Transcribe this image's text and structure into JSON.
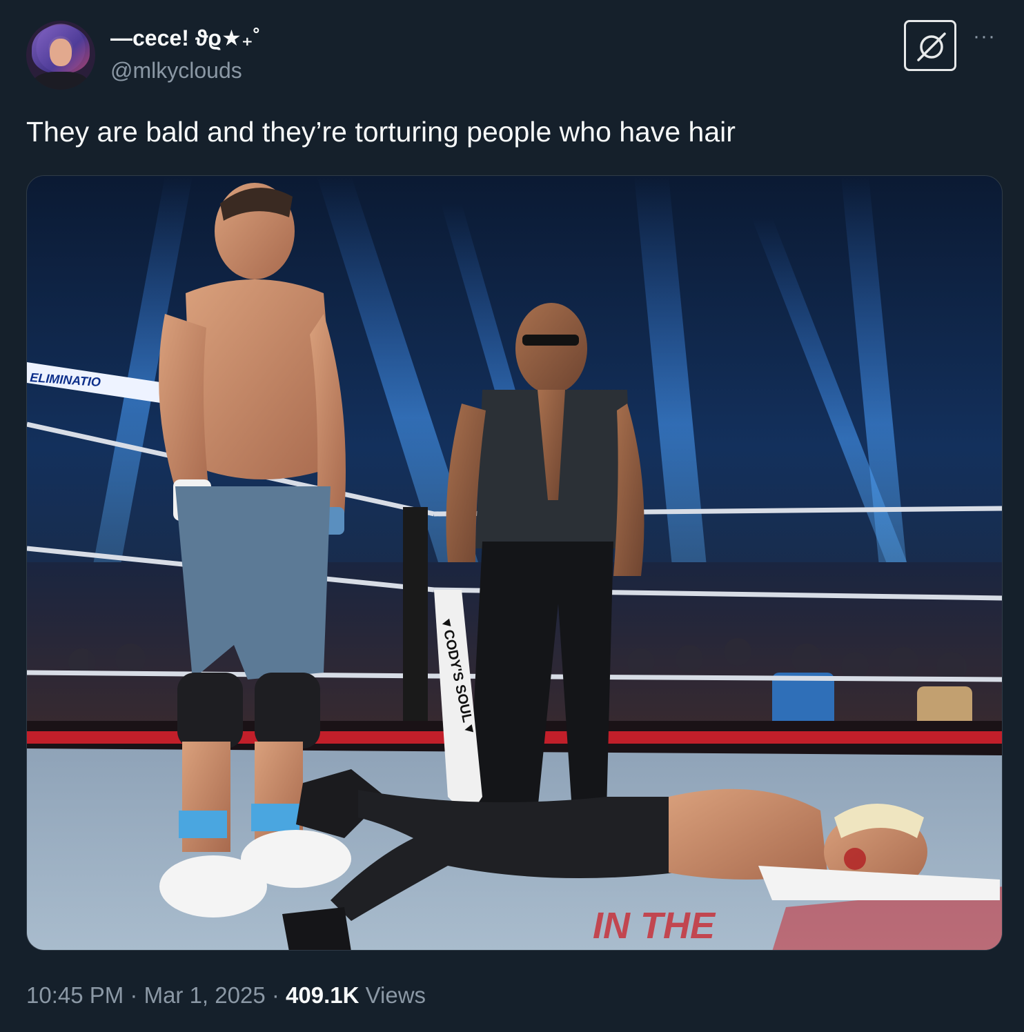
{
  "author": {
    "display_name": "—cece! ϑϱ★₊˚",
    "handle": "@mlkyclouds"
  },
  "icons": {
    "avatar": "profile-avatar",
    "grok": "grok-slash-circle-icon",
    "more": "more-horizontal-icon"
  },
  "more_label": "···",
  "tweet": {
    "text": "They are bald and they’re torturing people who have hair"
  },
  "media": {
    "banner_text": "ELIMINATIO",
    "mat_text": "IN THE",
    "sign_text": "▼CODY'S SOUL▼"
  },
  "meta": {
    "time": "10:45 PM",
    "separator": " · ",
    "date": "Mar 1, 2025",
    "views_count": "409.1K",
    "views_label": " Views"
  },
  "colors": {
    "background": "#15202b",
    "text_primary": "#f7f9f9",
    "text_secondary": "#8b98a5"
  }
}
